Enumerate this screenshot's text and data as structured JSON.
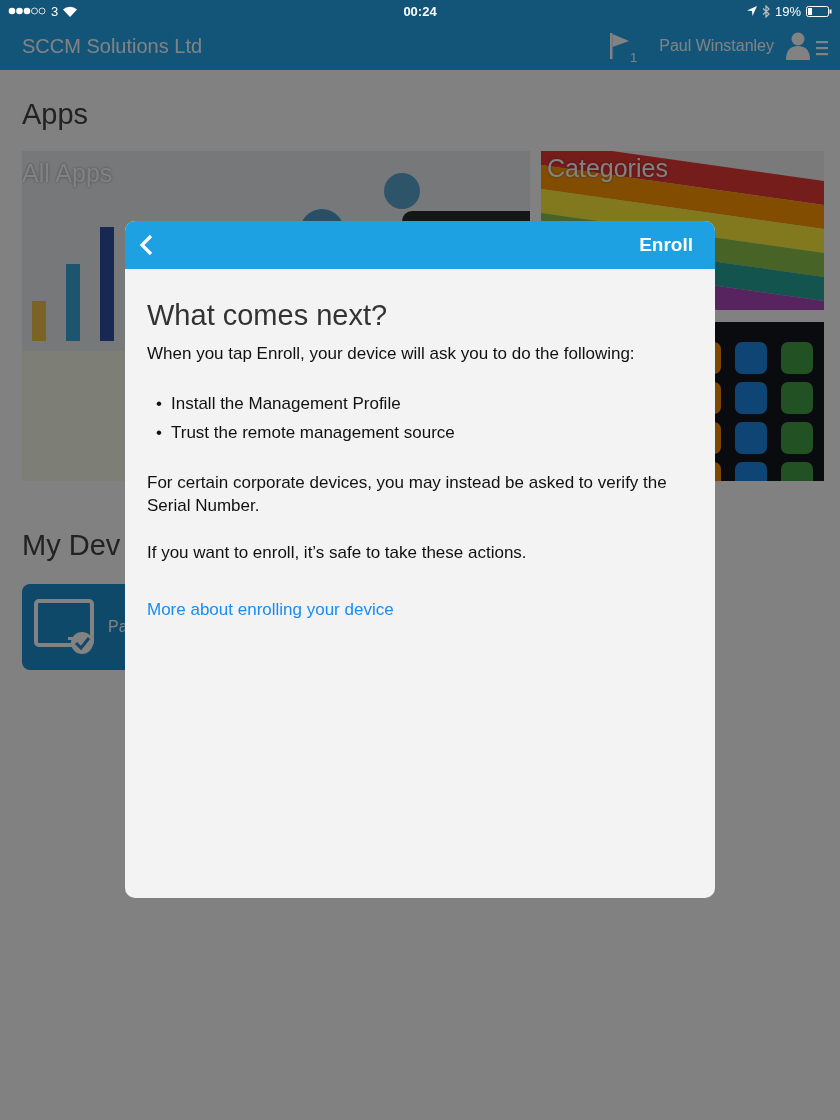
{
  "status_bar": {
    "carrier": "3",
    "time": "00:24",
    "battery": "19%"
  },
  "header": {
    "title": "SCCM Solutions Ltd",
    "notifications": "1",
    "user": "Paul Winstanley"
  },
  "apps": {
    "heading": "Apps",
    "tiles": [
      {
        "label": "All Apps"
      },
      {
        "label": "Categories"
      }
    ]
  },
  "devices": {
    "heading": "My Dev",
    "items": [
      {
        "name": "Pa"
      }
    ]
  },
  "dialog": {
    "action": "Enroll",
    "title": "What comes next?",
    "intro": "When you tap Enroll, your device will ask you to do the following:",
    "steps": [
      {
        "marker": "•",
        "text": "Install the Management Profile"
      },
      {
        "marker": "•",
        "text": "Trust the remote management source"
      }
    ],
    "note": "For certain corporate devices, you may instead be asked to verify the Serial Number.",
    "reassurance": "If you want to enroll, it’s safe to take these actions.",
    "link": "More about enrolling your device"
  }
}
